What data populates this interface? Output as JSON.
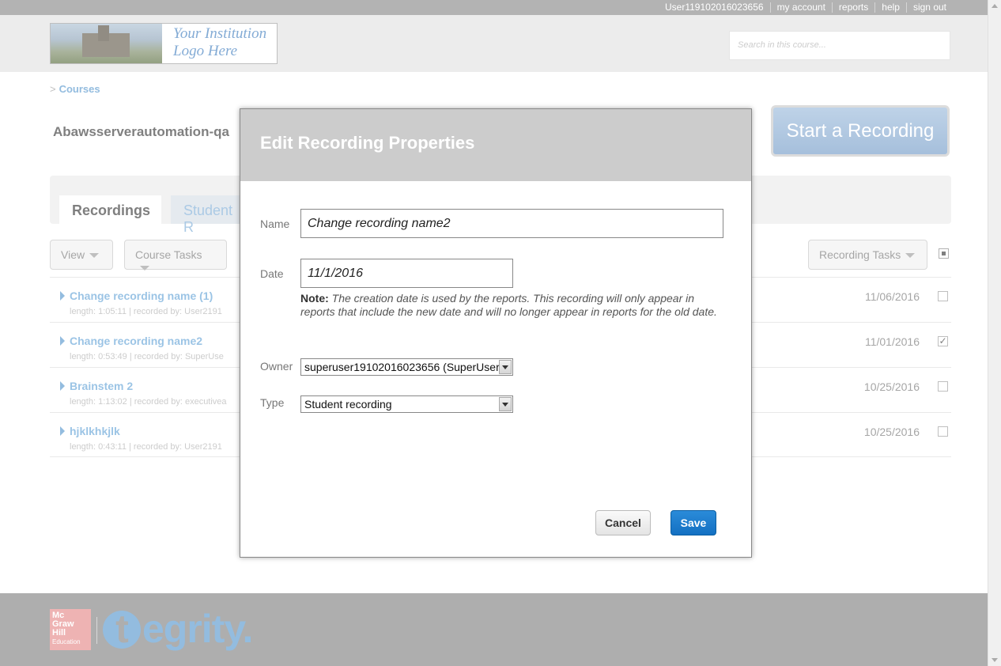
{
  "topbar": {
    "user": "User119102016023656",
    "my_account": "my account",
    "reports": "reports",
    "help": "help",
    "sign_out": "sign out"
  },
  "header": {
    "logo_text_line1": "Your Institution",
    "logo_text_line2": "Logo Here",
    "search_placeholder": "Search in this course..."
  },
  "breadcrumb": {
    "separator": ">",
    "courses": "Courses"
  },
  "course": {
    "title": "Abawsserverautomation-qa"
  },
  "start_recording": "Start a Recording",
  "tabs": [
    {
      "label": "Recordings"
    },
    {
      "label": "Student R"
    }
  ],
  "toolbar": {
    "view": "View",
    "course_tasks": "Course Tasks",
    "recording_tasks": "Recording Tasks"
  },
  "recordings": [
    {
      "title": "Change recording name (1)",
      "meta": "length: 1:05:11 | recorded by: User2191",
      "date": "11/06/2016",
      "checked": ""
    },
    {
      "title": "Change recording name2",
      "meta": "length: 0:53:49 | recorded by: SuperUse",
      "date": "11/01/2016",
      "checked": "✓"
    },
    {
      "title": "Brainstem 2",
      "meta": "length: 1:13:02 | recorded by: executivea",
      "date": "10/25/2016",
      "checked": ""
    },
    {
      "title": "hjklkhkjlk",
      "meta": "length: 0:43:11 | recorded by: User2191",
      "date": "10/25/2016",
      "checked": ""
    }
  ],
  "footer": {
    "brand_line1": "Mc",
    "brand_line2": "Graw",
    "brand_line3": "Hill",
    "brand_line4": "Education",
    "tegrity_t": "t",
    "tegrity_rest": "egrity."
  },
  "modal": {
    "title": "Edit Recording Properties",
    "name_label": "Name",
    "name_value": "Change recording name2",
    "date_label": "Date",
    "date_value": "11/1/2016",
    "note_label": "Note:",
    "note_text": "The creation date is used by the reports. This recording will only appear in reports that include the new date and will no longer appear in reports for the old date.",
    "owner_label": "Owner",
    "owner_value": "superuser19102016023656 (SuperUser",
    "type_label": "Type",
    "type_value": "Student recording",
    "cancel": "Cancel",
    "save": "Save"
  },
  "colors": {
    "accent_blue": "#6fa6d4",
    "save_blue": "#1470c2",
    "modal_header": "#cccccc"
  }
}
